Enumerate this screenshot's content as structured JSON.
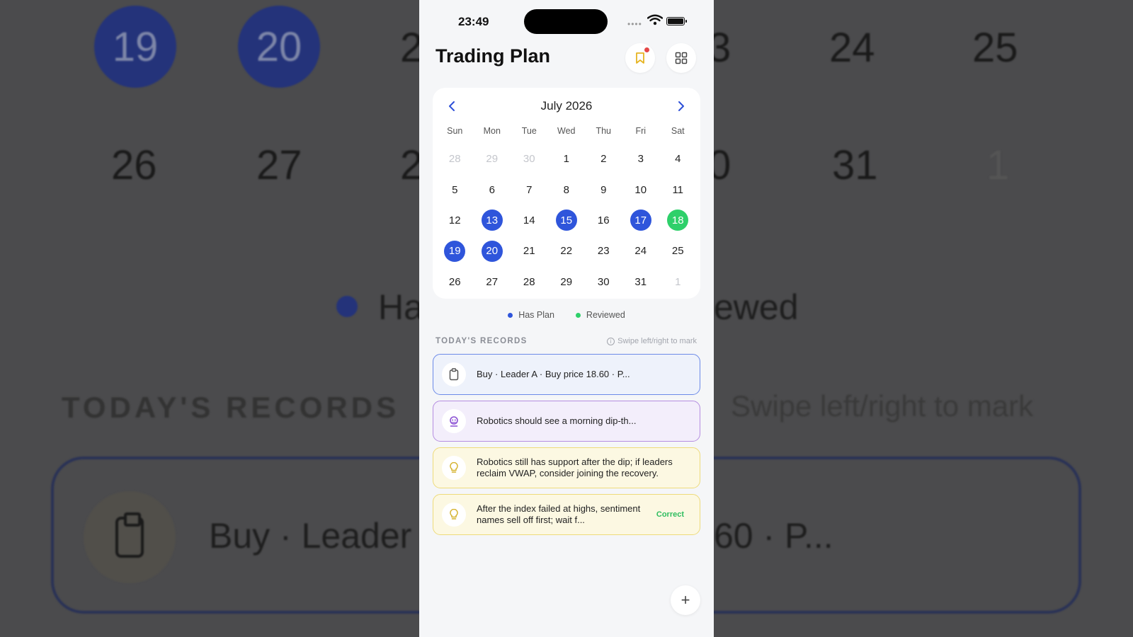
{
  "status_bar": {
    "time": "23:49",
    "signal": "••••"
  },
  "header": {
    "title": "Trading Plan",
    "bookmark_icon": "bookmark-icon",
    "grid_icon": "grid-icon"
  },
  "calendar": {
    "month_label": "July 2026",
    "weekdays": [
      "Sun",
      "Mon",
      "Tue",
      "Wed",
      "Thu",
      "Fri",
      "Sat"
    ],
    "days": [
      {
        "d": "28",
        "s": "muted"
      },
      {
        "d": "29",
        "s": "muted"
      },
      {
        "d": "30",
        "s": "muted"
      },
      {
        "d": "1",
        "s": ""
      },
      {
        "d": "2",
        "s": ""
      },
      {
        "d": "3",
        "s": ""
      },
      {
        "d": "4",
        "s": ""
      },
      {
        "d": "5",
        "s": ""
      },
      {
        "d": "6",
        "s": ""
      },
      {
        "d": "7",
        "s": ""
      },
      {
        "d": "8",
        "s": ""
      },
      {
        "d": "9",
        "s": ""
      },
      {
        "d": "10",
        "s": ""
      },
      {
        "d": "11",
        "s": ""
      },
      {
        "d": "12",
        "s": ""
      },
      {
        "d": "13",
        "s": "plan"
      },
      {
        "d": "14",
        "s": ""
      },
      {
        "d": "15",
        "s": "plan"
      },
      {
        "d": "16",
        "s": ""
      },
      {
        "d": "17",
        "s": "plan"
      },
      {
        "d": "18",
        "s": "reviewed"
      },
      {
        "d": "19",
        "s": "plan"
      },
      {
        "d": "20",
        "s": "plan"
      },
      {
        "d": "21",
        "s": ""
      },
      {
        "d": "22",
        "s": ""
      },
      {
        "d": "23",
        "s": ""
      },
      {
        "d": "24",
        "s": ""
      },
      {
        "d": "25",
        "s": ""
      },
      {
        "d": "26",
        "s": ""
      },
      {
        "d": "27",
        "s": ""
      },
      {
        "d": "28",
        "s": ""
      },
      {
        "d": "29",
        "s": ""
      },
      {
        "d": "30",
        "s": ""
      },
      {
        "d": "31",
        "s": ""
      },
      {
        "d": "1",
        "s": "muted"
      }
    ]
  },
  "legend": {
    "has_plan": {
      "label": "Has Plan",
      "color": "#2f55db"
    },
    "reviewed": {
      "label": "Reviewed",
      "color": "#2ed06a"
    }
  },
  "records": {
    "title": "TODAY'S RECORDS",
    "hint": "Swipe left/right to mark",
    "items": [
      {
        "icon": "clipboard-icon",
        "text": "Buy · Leader A · Buy price 18.60 · P...",
        "tag": ""
      },
      {
        "icon": "robot-icon",
        "text": "Robotics should see a morning dip-th...",
        "tag": ""
      },
      {
        "icon": "lightbulb-icon",
        "text": "Robotics still has support after the dip; if leaders reclaim VWAP, consider joining the recovery.",
        "tag": ""
      },
      {
        "icon": "lightbulb-icon",
        "text": "After the index failed at highs, sentiment names sell off first; wait f...",
        "tag": "Correct"
      }
    ]
  },
  "fab": {
    "label": "+"
  },
  "backdrop": {
    "row1": [
      "19",
      "20",
      "2",
      "3",
      "24",
      "25"
    ],
    "row2": [
      "26",
      "27",
      "2",
      "0",
      "31",
      "1"
    ],
    "legend_left": "Ha",
    "legend_right": "ewed",
    "records_title": "TODAY'S RECORDS",
    "hint_text": "Swipe left/right to mark",
    "card_left": "Buy · Leader",
    "card_right": "60 · P..."
  }
}
